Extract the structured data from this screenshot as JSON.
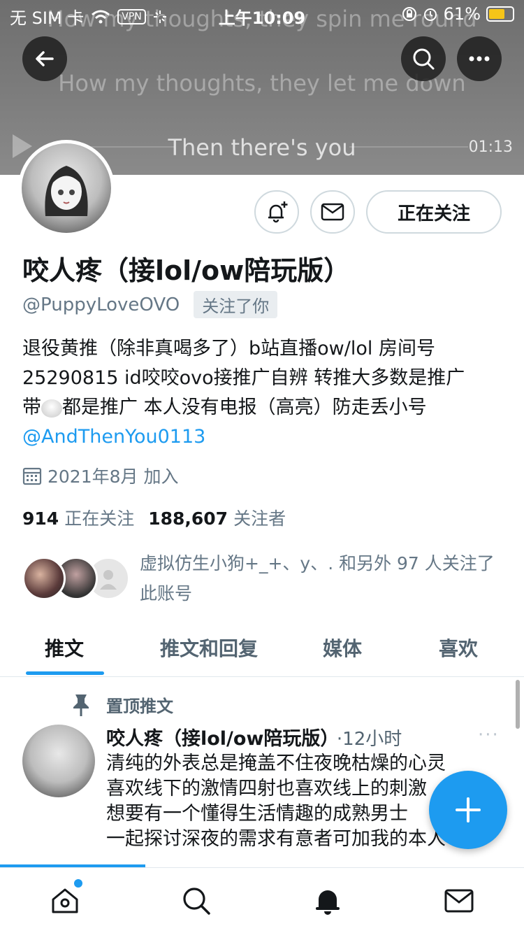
{
  "status_bar": {
    "carrier": "无 SIM 卡",
    "vpn": "VPN",
    "time": "上午10:09",
    "battery": "61%"
  },
  "banner": {
    "lyrics": [
      "How my thoughts, they spin me round",
      "How my thoughts, they let me down",
      "Then there's you"
    ],
    "time": "01:13"
  },
  "profile": {
    "name": "咬人疼（接lol/ow陪玩版）",
    "handle": "@PuppyLoveOVO",
    "follows_you": "关注了你",
    "follow_button": "正在关注",
    "bio_line1": "退役黄推（除非真喝多了）b站直播ow/lol 房间号",
    "bio_line2": "25290815 id咬咬ovo接推广自辨 转推大多数是推广",
    "bio_line3a": "带",
    "bio_line3b": "都是推广 本人没有电报（高亮）防走丢小号",
    "bio_mention": "@AndThenYou0113",
    "joined": "2021年8月 加入",
    "following_count": "914",
    "following_label": "正在关注",
    "followers_count": "188,607",
    "followers_label": "关注者",
    "known_followers": "虚拟仿生小狗+_+、y、. 和另外 97 人关注了此账号"
  },
  "tabs": [
    "推文",
    "推文和回复",
    "媒体",
    "喜欢"
  ],
  "tweet": {
    "pinned_label": "置顶推文",
    "author": "咬人疼（接lol/ow陪玩版）",
    "time": "·12小时",
    "more": "···",
    "body_lines": [
      "清纯的外表总是掩盖不住夜晚枯燥的心灵",
      "喜欢线下的激情四射也喜欢线上的刺激",
      "想要有一个懂得生活情趣的成熟男士",
      "一起探讨深夜的需求有意者可加我的本人"
    ]
  },
  "colors": {
    "accent": "#1d9bf0",
    "muted": "#657786",
    "text": "#14171a"
  },
  "icons": {
    "back": "arrow-left-icon",
    "search": "search-icon",
    "more": "more-horizontal-icon",
    "notify": "bell-plus-icon",
    "message": "mail-icon",
    "calendar": "calendar-icon",
    "pin": "pin-icon",
    "compose": "plus-icon",
    "nav_home": "home-icon",
    "nav_search": "search-icon",
    "nav_notifications": "bell-icon",
    "nav_messages": "mail-icon"
  }
}
